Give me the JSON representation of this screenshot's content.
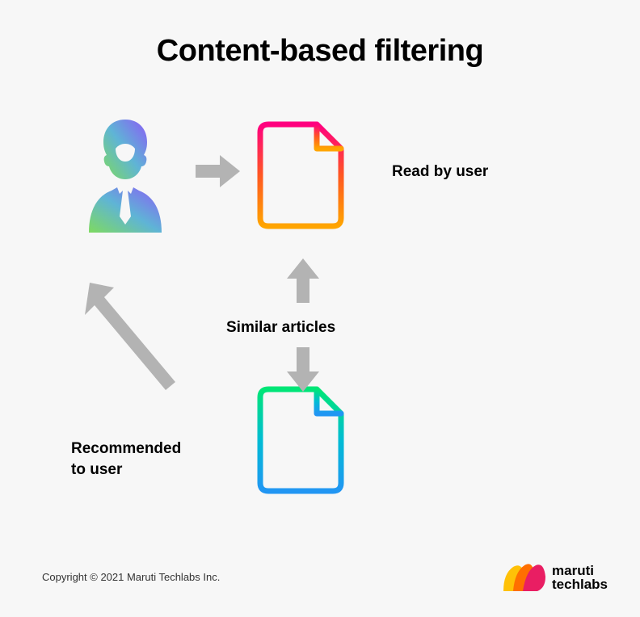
{
  "title": "Content-based filtering",
  "labels": {
    "read_by_user": "Read by user",
    "similar_articles": "Similar articles",
    "recommended_line1": "Recommended",
    "recommended_line2": "to user"
  },
  "copyright": "Copyright © 2021 Maruti Techlabs Inc.",
  "logo": {
    "line1": "maruti",
    "line2": "techlabs"
  },
  "icons": {
    "user": "user-icon",
    "document_read": "document-icon",
    "document_recommended": "document-icon",
    "arrow_right": "arrow-right-icon",
    "arrow_up": "arrow-up-icon",
    "arrow_down": "arrow-down-icon",
    "arrow_diagonal": "arrow-diagonal-icon"
  },
  "colors": {
    "user_gradient_start": "#7eda5f",
    "user_gradient_end": "#8b5cf6",
    "doc1_gradient_start": "#ff0080",
    "doc1_gradient_end": "#ffa500",
    "doc2_gradient_start": "#00e676",
    "doc2_gradient_end": "#2196f3",
    "arrow": "#b3b3b3",
    "logo_yellow": "#ffc107",
    "logo_orange": "#ff6f00",
    "logo_pink": "#e91e63"
  }
}
